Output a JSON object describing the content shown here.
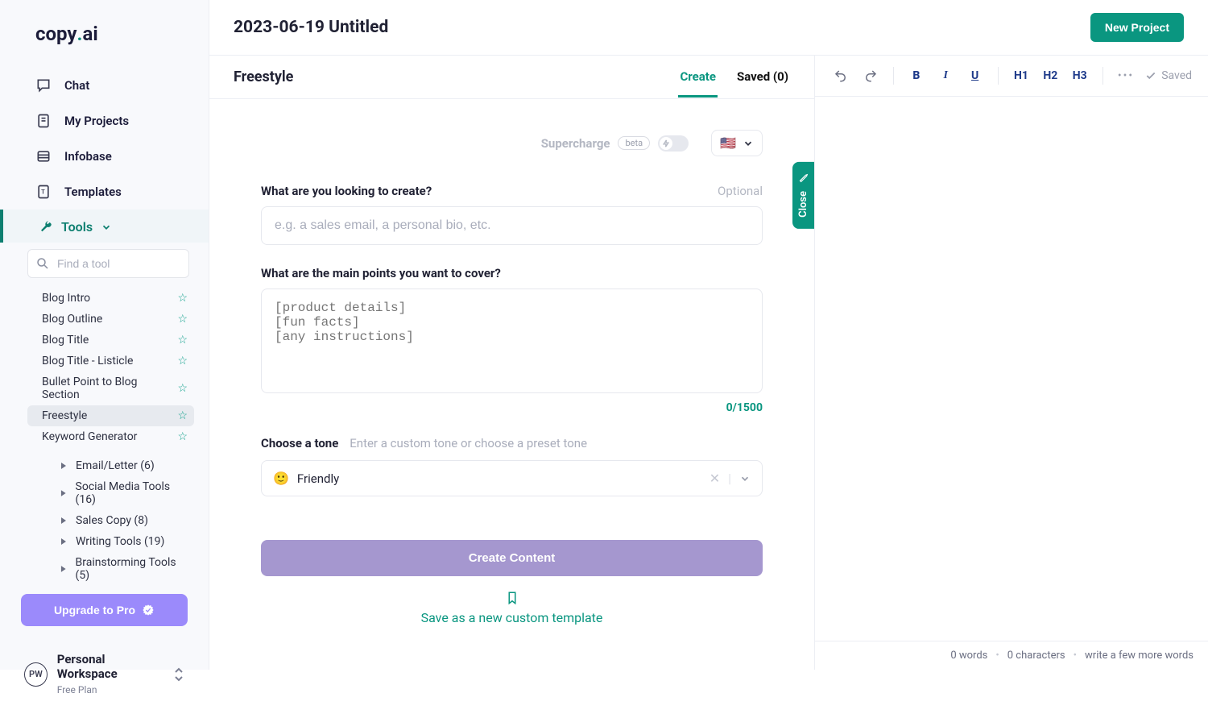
{
  "brand": {
    "part1": "copy",
    "dot": ".",
    "part2": "ai"
  },
  "nav": {
    "chat": "Chat",
    "projects": "My Projects",
    "infobase": "Infobase",
    "templates": "Templates",
    "tools": "Tools"
  },
  "toolsearch_placeholder": "Find a tool",
  "tools_list": [
    {
      "label": "Blog Intro"
    },
    {
      "label": "Blog Outline"
    },
    {
      "label": "Blog Title"
    },
    {
      "label": "Blog Title - Listicle"
    },
    {
      "label": "Bullet Point to Blog Section"
    },
    {
      "label": "Freestyle"
    },
    {
      "label": "Keyword Generator"
    }
  ],
  "tool_cats": [
    {
      "label": "Email/Letter (6)"
    },
    {
      "label": "Social Media Tools (16)"
    },
    {
      "label": "Sales Copy (8)"
    },
    {
      "label": "Writing Tools (19)"
    },
    {
      "label": "Brainstorming Tools (5)"
    }
  ],
  "upgrade": "Upgrade to Pro",
  "workspace": {
    "avatar": "PW",
    "name": "Personal Workspace",
    "plan": "Free Plan"
  },
  "header": {
    "title": "2023-06-19 Untitled",
    "new_project": "New Project"
  },
  "freestyle": {
    "title": "Freestyle",
    "tab_create": "Create",
    "tab_saved": "Saved (0)",
    "supercharge": "Supercharge",
    "beta": "beta",
    "flag": "🇺🇸",
    "q1": "What are you looking to create?",
    "q1_optional": "Optional",
    "q1_ph": "e.g. a sales email, a personal bio, etc.",
    "q2": "What are the main points you want to cover?",
    "q2_ph": "[product details]\n[fun facts]\n[any instructions]",
    "counter": "0/1500",
    "tone_label": "Choose a tone",
    "tone_hint": "Enter a custom tone or choose a preset tone",
    "tone_emoji": "🙂",
    "tone_value": "Friendly",
    "create_btn": "Create Content",
    "save_tmpl": "Save as a new custom template",
    "close": "Close"
  },
  "editor": {
    "h1": "H1",
    "h2": "H2",
    "h3": "H3",
    "b": "B",
    "i": "I",
    "u": "U",
    "saved": "Saved",
    "status_words": "0 words",
    "status_chars": "0 characters",
    "status_hint": "write a few more words"
  }
}
